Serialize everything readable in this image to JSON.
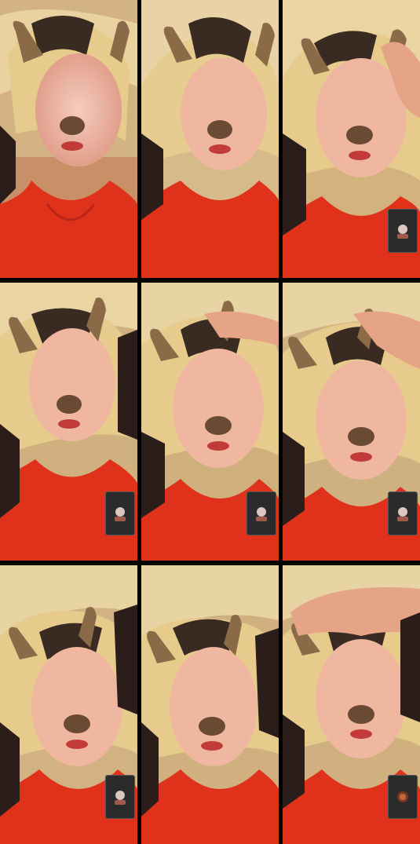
{
  "tiles": [
    {
      "id": 1,
      "has_pip": false,
      "face": "dog-filter",
      "tone": "warm"
    },
    {
      "id": 2,
      "has_pip": false,
      "face": "dog-filter",
      "tone": "warm"
    },
    {
      "id": 3,
      "has_pip": true,
      "face": "dog-filter",
      "tone": "warm"
    },
    {
      "id": 4,
      "has_pip": true,
      "face": "dog-filter",
      "tone": "warm"
    },
    {
      "id": 5,
      "has_pip": true,
      "face": "dog-filter",
      "tone": "warm"
    },
    {
      "id": 6,
      "has_pip": true,
      "face": "dog-filter",
      "tone": "warm"
    },
    {
      "id": 7,
      "has_pip": true,
      "face": "dog-filter",
      "tone": "warm"
    },
    {
      "id": 8,
      "has_pip": false,
      "face": "dog-filter",
      "tone": "warm"
    },
    {
      "id": 9,
      "has_pip": true,
      "face": "dog-filter",
      "tone": "warm"
    }
  ],
  "colors": {
    "wall": "#d9c08e",
    "hair": "#e8cf8f",
    "hair_dark": "#3a2b22",
    "skin": "#e7b08a",
    "glitter": "#f4c7b6",
    "ear": "#8b6b47",
    "ear_inner": "#d9a8a0",
    "nose": "#6a4a33",
    "top": "#e0321b",
    "pattern": "#2a1d1a"
  }
}
